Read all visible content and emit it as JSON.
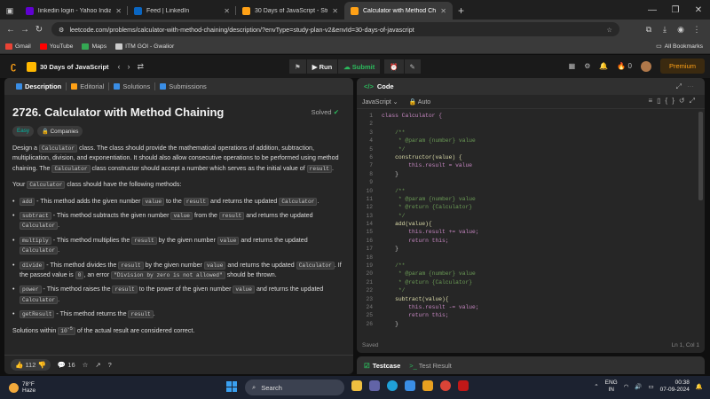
{
  "browser": {
    "tabs": [
      {
        "title": "linkedin login - Yahoo India Se",
        "color": "#6001d2"
      },
      {
        "title": "Feed | LinkedIn",
        "color": "#0a66c2"
      },
      {
        "title": "30 Days of JavaScript - Study P",
        "color": "#ffa116"
      },
      {
        "title": "Calculator with Method Chainin",
        "color": "#ffa116"
      }
    ],
    "url": "leetcode.com/problems/calculator-with-method-chaining/description/?envType=study-plan-v2&envId=30-days-of-javascript",
    "bookmarks": [
      {
        "label": "Gmail",
        "color": "#ea4335"
      },
      {
        "label": "YouTube",
        "color": "#ff0000"
      },
      {
        "label": "Maps",
        "color": "#34a853"
      },
      {
        "label": "ITM GOI - Gwalior",
        "color": "#cccccc"
      }
    ],
    "all_bookmarks": "All Bookmarks"
  },
  "lc": {
    "study_plan": "30 Days of JavaScript",
    "run": "Run",
    "submit": "Submit",
    "coins": "0",
    "premium": "Premium"
  },
  "left": {
    "tabs": [
      "Description",
      "Editorial",
      "Solutions",
      "Submissions"
    ],
    "title": "2726. Calculator with Method Chaining",
    "solved": "Solved",
    "difficulty": "Easy",
    "companies": "Companies",
    "likes": "112",
    "comments": "16"
  },
  "right": {
    "panel": "Code",
    "language": "JavaScript",
    "mode": "Auto",
    "saved": "Saved",
    "cursor": "Ln 1, Col 1",
    "code": [
      "class Calculator {",
      "",
      "    /**",
      "     * @param {number} value",
      "     */",
      "    constructor(value) {",
      "        this.result = value",
      "    }",
      "",
      "    /**",
      "     * @param {number} value",
      "     * @return {Calculator}",
      "     */",
      "    add(value){",
      "        this.result += value;",
      "        return this;",
      "    }",
      "",
      "    /**",
      "     * @param {number} value",
      "     * @return {Calculator}",
      "     */",
      "    subtract(value){",
      "        this.result -= value;",
      "        return this;",
      "    }"
    ]
  },
  "testcase": {
    "tab1": "Testcase",
    "tab2": "Test Result"
  },
  "taskbar": {
    "temp": "78°F",
    "weather": "Haze",
    "search": "Search",
    "lang1": "ENG",
    "lang2": "IN",
    "time": "00:38",
    "date": "07-09-2024"
  }
}
